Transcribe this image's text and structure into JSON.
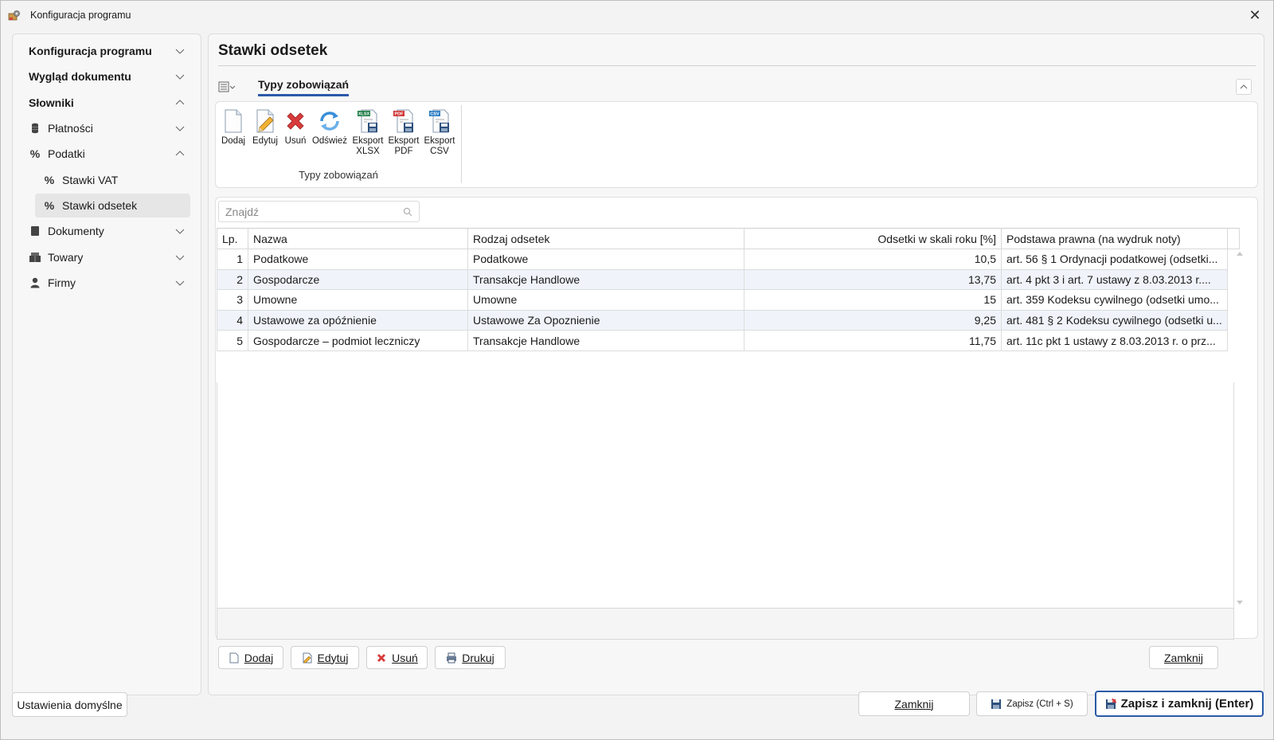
{
  "window": {
    "title": "Konfiguracja programu",
    "close_glyph": "✕"
  },
  "sidebar": {
    "items": [
      {
        "label": "Konfiguracja programu",
        "icon": "",
        "level": 0,
        "expanded": false
      },
      {
        "label": "Wygląd dokumentu",
        "icon": "",
        "level": 0,
        "expanded": false
      },
      {
        "label": "Słowniki",
        "icon": "",
        "level": 0,
        "expanded": true
      },
      {
        "label": "Płatności",
        "icon": "cylinder-icon",
        "level": 1,
        "expanded": false
      },
      {
        "label": "Podatki",
        "icon": "percent-icon",
        "level": 1,
        "expanded": true
      },
      {
        "label": "Stawki VAT",
        "icon": "percent-icon",
        "level": 2
      },
      {
        "label": "Stawki odsetek",
        "icon": "percent-icon",
        "level": 2,
        "selected": true
      },
      {
        "label": "Dokumenty",
        "icon": "document-icon",
        "level": 1,
        "expanded": false
      },
      {
        "label": "Towary",
        "icon": "boxes-icon",
        "level": 1,
        "expanded": false
      },
      {
        "label": "Firmy",
        "icon": "person-icon",
        "level": 1,
        "expanded": false
      }
    ]
  },
  "main": {
    "title": "Stawki odsetek",
    "ribbon_tab": "Typy zobowiązań",
    "ribbon_group": "Typy zobowiązań",
    "ribbon_buttons": {
      "add": "Dodaj",
      "edit": "Edytuj",
      "delete": "Usuń",
      "refresh": "Odśwież",
      "export_xlsx_1": "Eksport",
      "export_xlsx_2": "XLSX",
      "export_pdf_1": "Eksport",
      "export_pdf_2": "PDF",
      "export_csv_1": "Eksport",
      "export_csv_2": "CSV",
      "xlsx_badge": "XLSX",
      "pdf_badge": "PDF",
      "csv_badge": "CSV"
    },
    "search": {
      "placeholder": "Znajdź",
      "value": ""
    },
    "grid": {
      "columns": [
        "Lp.",
        "Nazwa",
        "Rodzaj odsetek",
        "Odsetki w skali roku [%]",
        "Podstawa prawna (na wydruk noty)"
      ],
      "rows": [
        {
          "lp": "1",
          "nazwa": "Podatkowe",
          "rodzaj": "Podatkowe",
          "odsetki": "10,5",
          "podstawa": "art. 56 § 1 Ordynacji podatkowej (odsetki..."
        },
        {
          "lp": "2",
          "nazwa": "Gospodarcze",
          "rodzaj": "Transakcje Handlowe",
          "odsetki": "13,75",
          "podstawa": "art. 4 pkt 3 i art. 7 ustawy z 8.03.2013 r...."
        },
        {
          "lp": "3",
          "nazwa": "Umowne",
          "rodzaj": "Umowne",
          "odsetki": "15",
          "podstawa": "art. 359 Kodeksu cywilnego (odsetki umo..."
        },
        {
          "lp": "4",
          "nazwa": "Ustawowe za opóźnienie",
          "rodzaj": "Ustawowe Za Opoznienie",
          "odsetki": "9,25",
          "podstawa": "art. 481 § 2 Kodeksu cywilnego (odsetki u..."
        },
        {
          "lp": "5",
          "nazwa": "Gospodarcze – podmiot leczniczy",
          "rodzaj": "Transakcje Handlowe",
          "odsetki": "11,75",
          "podstawa": "art. 11c pkt 1 ustawy z 8.03.2013 r. o prz..."
        }
      ]
    },
    "actions": {
      "add": "Dodaj",
      "edit": "Edytuj",
      "delete": "Usuń",
      "print": "Drukuj",
      "close": "Zamknij"
    }
  },
  "footer": {
    "defaults": "Ustawienia domyślne",
    "close": "Zamknij",
    "save": "Zapisz (Ctrl + S)",
    "save_close": "Zapisz i zamknij (Enter)"
  },
  "colors": {
    "accent": "#2a5aa8",
    "delete_red": "#d83b3b",
    "row_alt": "#f0f4fa",
    "excel_green": "#1e7b45",
    "pdf_red": "#d03434",
    "csv_blue": "#2b7cc4"
  }
}
